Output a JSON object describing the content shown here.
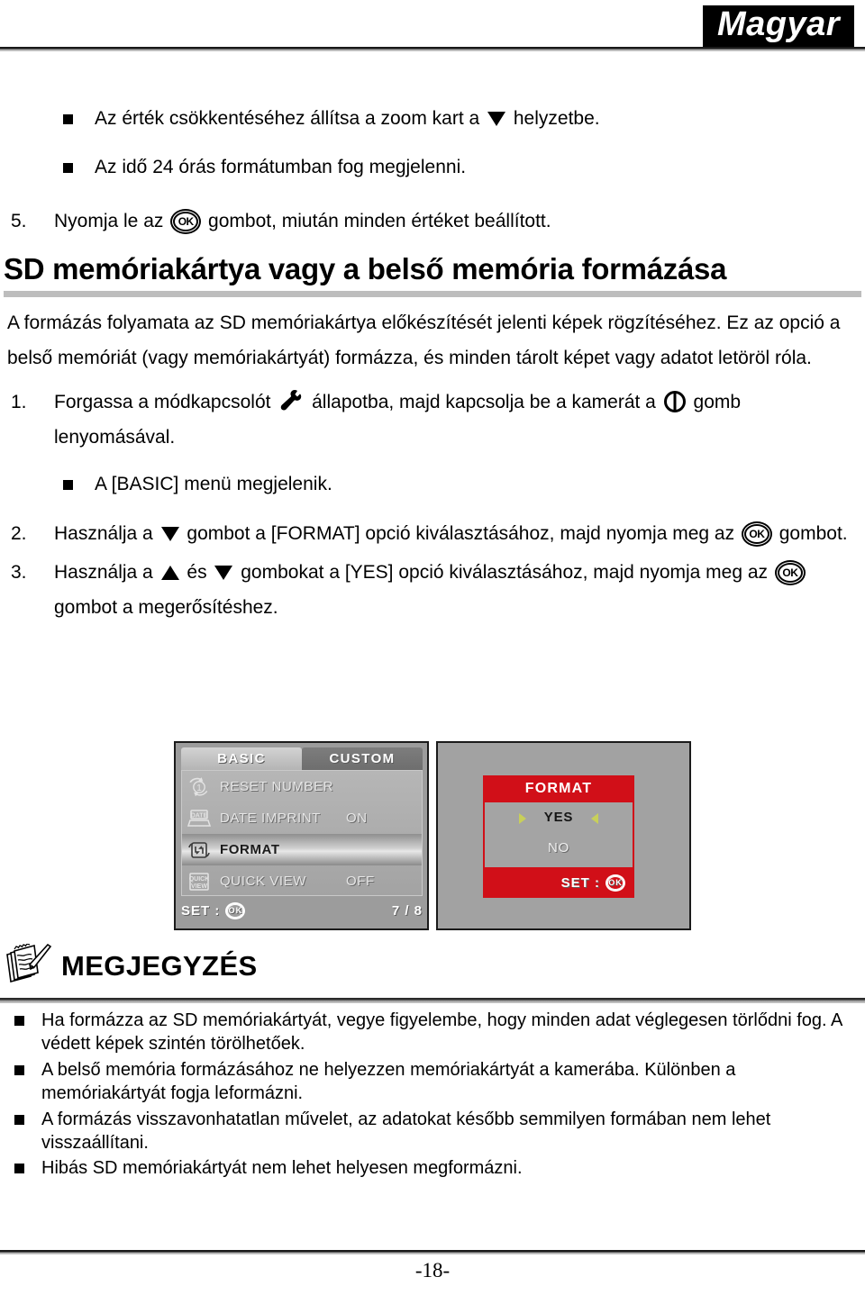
{
  "header": {
    "language_badge": "Magyar"
  },
  "top_bullets": [
    "Az érték csökkentéséhez állítsa a zoom kart a ▼ helyzetbe.",
    "Az idő 24 órás formátumban fog megjelenni."
  ],
  "top_bullet_parts": {
    "b1_before": "Az érték csökkentéséhez állítsa a zoom kart a ",
    "b1_after": " helyzetbe.",
    "b2": "Az idő 24 órás formátumban fog megjelenni."
  },
  "step5": {
    "number": "5.",
    "before": "Nyomja le az ",
    "after": " gombot, miután minden értéket beállított."
  },
  "section": {
    "title": "SD memóriakártya vagy a belső memória formázása",
    "paragraph": "A formázás folyamata az SD memóriakártya előkészítését jelenti képek rögzítéséhez. Ez az opció a belső memóriát (vagy memóriakártyát) formázza, és minden tárolt képet vagy adatot letöröl róla."
  },
  "steps": {
    "step1": {
      "number": "1.",
      "part1": "Forgassa a módkapcsolót ",
      "part2": " állapotba, majd kapcsolja be a kamerát a ",
      "part3": " gomb lenyomásával.",
      "sub_bullet": "A [BASIC] menü megjelenik."
    },
    "step2": {
      "number": "2.",
      "part1": "Használja a ",
      "part2": " gombot a [FORMAT] opció kiválasztásához, majd nyomja meg az ",
      "part3": " gombot."
    },
    "step3": {
      "number": "3.",
      "part1": "Használja a ",
      "part2": " és ",
      "part3": " gombokat a [YES] opció kiválasztásához, majd nyomja meg az ",
      "part4": " gombot a megerősítéshez."
    }
  },
  "ok_button_label": "OK",
  "camera_screens": {
    "menu_screen": {
      "tabs": [
        {
          "label": "BASIC",
          "active": true
        },
        {
          "label": "CUSTOM",
          "active": false
        }
      ],
      "rows": [
        {
          "icon": "reset-number-icon",
          "label": "RESET NUMBER",
          "value": "",
          "selected": false
        },
        {
          "icon": "date-imprint-icon",
          "label": "DATE IMPRINT",
          "value": "ON",
          "selected": false
        },
        {
          "icon": "format-icon",
          "label": "FORMAT",
          "value": "",
          "selected": true
        },
        {
          "icon": "quick-view-icon",
          "label": "QUICK VIEW",
          "value": "OFF",
          "selected": false
        }
      ],
      "footer": {
        "set_label": "SET :",
        "ok_label": "OK",
        "page_count": "7 / 8"
      }
    },
    "format_dialog": {
      "title": "FORMAT",
      "options": [
        {
          "label": "YES",
          "selected": true
        },
        {
          "label": "NO",
          "selected": false
        }
      ],
      "footer": {
        "set_label": "SET :",
        "ok_label": "OK"
      },
      "accent_color": "#d10f18",
      "arrow_color": "#c8cf5a"
    }
  },
  "note": {
    "title": "MEGJEGYZÉS",
    "items": [
      "Ha formázza az SD memóriakártyát, vegye figyelembe, hogy minden adat véglegesen törlődni fog. A védett képek szintén törölhetőek.",
      "A belső memória formázásához ne helyezzen memóriakártyát a kamerába. Különben a memóriakártyát fogja leformázni.",
      "A formázás visszavonhatatlan művelet, az adatokat később semmilyen formában nem lehet visszaállítani.",
      "Hibás SD memóriakártyát nem lehet helyesen megformázni."
    ]
  },
  "footer": {
    "page_number": "-18-"
  }
}
